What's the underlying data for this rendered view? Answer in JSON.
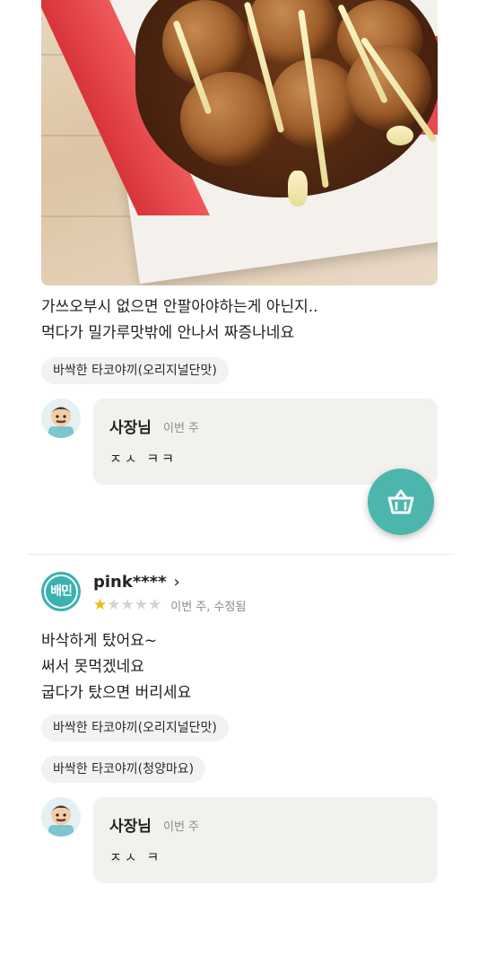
{
  "review1": {
    "photo_icon": "takoyaki-photo",
    "text_line1": "가쓰오부시 없으면 안팔아야하는게 아닌지..",
    "text_line2": "먹다가 밀가루맛밖에 안나서 짜증나네요",
    "menu_chip": "바싹한 타코야끼(오리지널단맛)",
    "reply": {
      "owner": "사장님",
      "when": "이번 주",
      "text": "ㅈㅅ ㅋㅋ"
    }
  },
  "cart_button": {
    "icon": "basket-icon",
    "color": "#4db6ac"
  },
  "review2": {
    "avatar_text": "배민",
    "username": "pink****",
    "chevron": "›",
    "rating": 1,
    "rating_max": 5,
    "meta": "이번 주, 수정됨",
    "text_line1": "바삭하게 탔어요~",
    "text_line2": "써서 못먹겠네요",
    "text_line3": "굽다가 탔으면 버리세요",
    "menu_chip1": "바싹한 타코야끼(오리지널단맛)",
    "menu_chip2": "바싹한 타코야끼(청양마요)",
    "reply": {
      "owner": "사장님",
      "when": "이번 주",
      "text": "ㅈㅅ ㅋ"
    }
  },
  "colors": {
    "accent": "#4db6ac",
    "star": "#f5b800",
    "bubble": "#f3f1ed"
  }
}
